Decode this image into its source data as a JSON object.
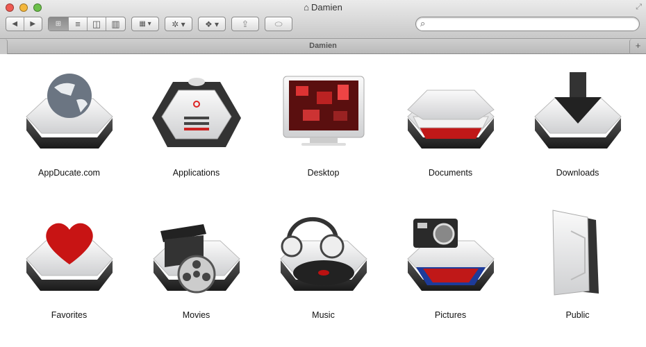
{
  "window": {
    "title": "Damien",
    "path_label": "Damien"
  },
  "toolbar": {
    "back": "◀",
    "forward": "▶",
    "view_icon": "⊞",
    "view_list": "≡",
    "view_column": "◫",
    "view_coverflow": "▥",
    "arrange": "▦ ▾",
    "action": "✲ ▾",
    "dropbox": "❖ ▾",
    "share": "⇪",
    "toggle": "⬭"
  },
  "search": {
    "placeholder": "",
    "value": ""
  },
  "items": [
    {
      "label": "AppDucate.com",
      "icon": "globe-drive-icon"
    },
    {
      "label": "Applications",
      "icon": "applications-drive-icon"
    },
    {
      "label": "Desktop",
      "icon": "desktop-monitor-icon"
    },
    {
      "label": "Documents",
      "icon": "documents-drive-icon"
    },
    {
      "label": "Downloads",
      "icon": "downloads-drive-icon"
    },
    {
      "label": "Favorites",
      "icon": "heart-drive-icon"
    },
    {
      "label": "Movies",
      "icon": "movies-drive-icon"
    },
    {
      "label": "Music",
      "icon": "music-drive-icon"
    },
    {
      "label": "Pictures",
      "icon": "camera-drive-icon"
    },
    {
      "label": "Public",
      "icon": "public-folder-icon"
    }
  ]
}
